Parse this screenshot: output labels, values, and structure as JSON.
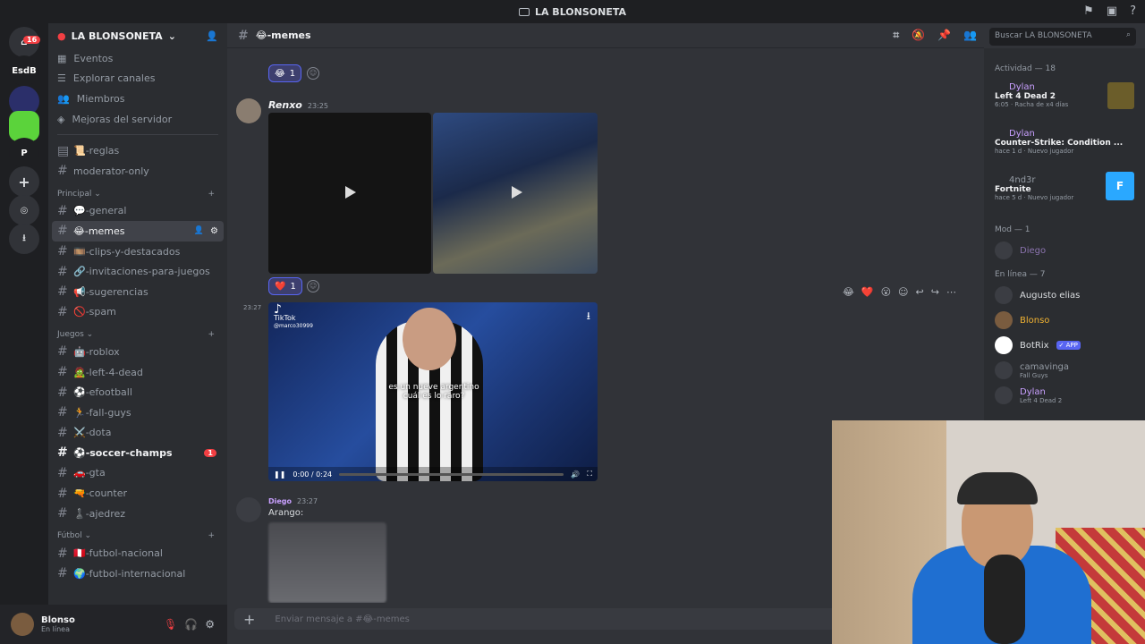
{
  "window": {
    "title": "LA BLONSONETA"
  },
  "rail": {
    "badge": "16",
    "servers": [
      "EsdB",
      "P"
    ]
  },
  "server": {
    "name": "LA BLONSONETA"
  },
  "nav": [
    "Eventos",
    "Explorar canales",
    "Miembros",
    "Mejoras del servidor"
  ],
  "top_channels": [
    "📜-reglas",
    "moderator-only"
  ],
  "categories": [
    {
      "name": "Principal",
      "channels": [
        "💬-general",
        "😂-memes",
        "🎞️-clips-y-destacados",
        "🔗-invitaciones-para-juegos",
        "📢-sugerencias",
        "🚫-spam"
      ]
    },
    {
      "name": "Juegos",
      "channels": [
        "🤖-roblox",
        "🧟-left-4-dead",
        "⚽-efootball",
        "🏃-fall-guys",
        "⚔️-dota",
        "⚽-soccer-champs",
        "🚗-gta",
        "🔫-counter",
        "♟️-ajedrez"
      ]
    },
    {
      "name": "Fútbol",
      "channels": [
        "🇵🇪-futbol-nacional",
        "🌍-futbol-internacional"
      ]
    }
  ],
  "soccer_badge": "1",
  "user": {
    "name": "Blonso",
    "status": "En línea"
  },
  "chat": {
    "channel": "😂-memes",
    "search_placeholder": "Buscar LA BLONSONETA",
    "input_placeholder": "Enviar mensaje a #😂-memes",
    "messages": [
      {
        "author": "Renxo",
        "time": "23:25"
      },
      {
        "time_left": "23:27",
        "video_caption": "es un nueve argentino\ncuál es lo raro?",
        "tiktok": "TikTok",
        "tiktok_user": "@marco30999",
        "player_time": "0:00 / 0:24"
      },
      {
        "author": "Diego",
        "time": "23:27",
        "text": "Arango:"
      }
    ],
    "reactions": [
      {
        "emoji": "😂",
        "count": "1"
      },
      {
        "emoji": "❤️",
        "count": "1"
      }
    ],
    "hover_reactions": [
      "😂",
      "❤️",
      "😮"
    ]
  },
  "members": {
    "activity_title": "Actividad — 18",
    "activities": [
      {
        "user": "Dylan",
        "game": "Left 4 Dead 2",
        "sub": "6:05 · Racha de x4 días"
      },
      {
        "user": "Dylan",
        "game": "Counter-Strike: Condition ...",
        "sub": "hace 1 d · Nuevo jugador"
      },
      {
        "user": "4nd3r",
        "game": "Fortnite",
        "sub": "hace 5 d · Nuevo jugador"
      }
    ],
    "mod_title": "Mod — 1",
    "mods": [
      "Diego"
    ],
    "online_title": "En línea — 7",
    "online": [
      {
        "name": "Augusto elias",
        "sub": ""
      },
      {
        "name": "Blonso",
        "sub": ""
      },
      {
        "name": "BotRix",
        "sub": "",
        "tag": "✓ APP"
      },
      {
        "name": "camavinga",
        "sub": "Fall Guys"
      },
      {
        "name": "Dylan",
        "sub": "Left 4 Dead 2"
      }
    ]
  }
}
